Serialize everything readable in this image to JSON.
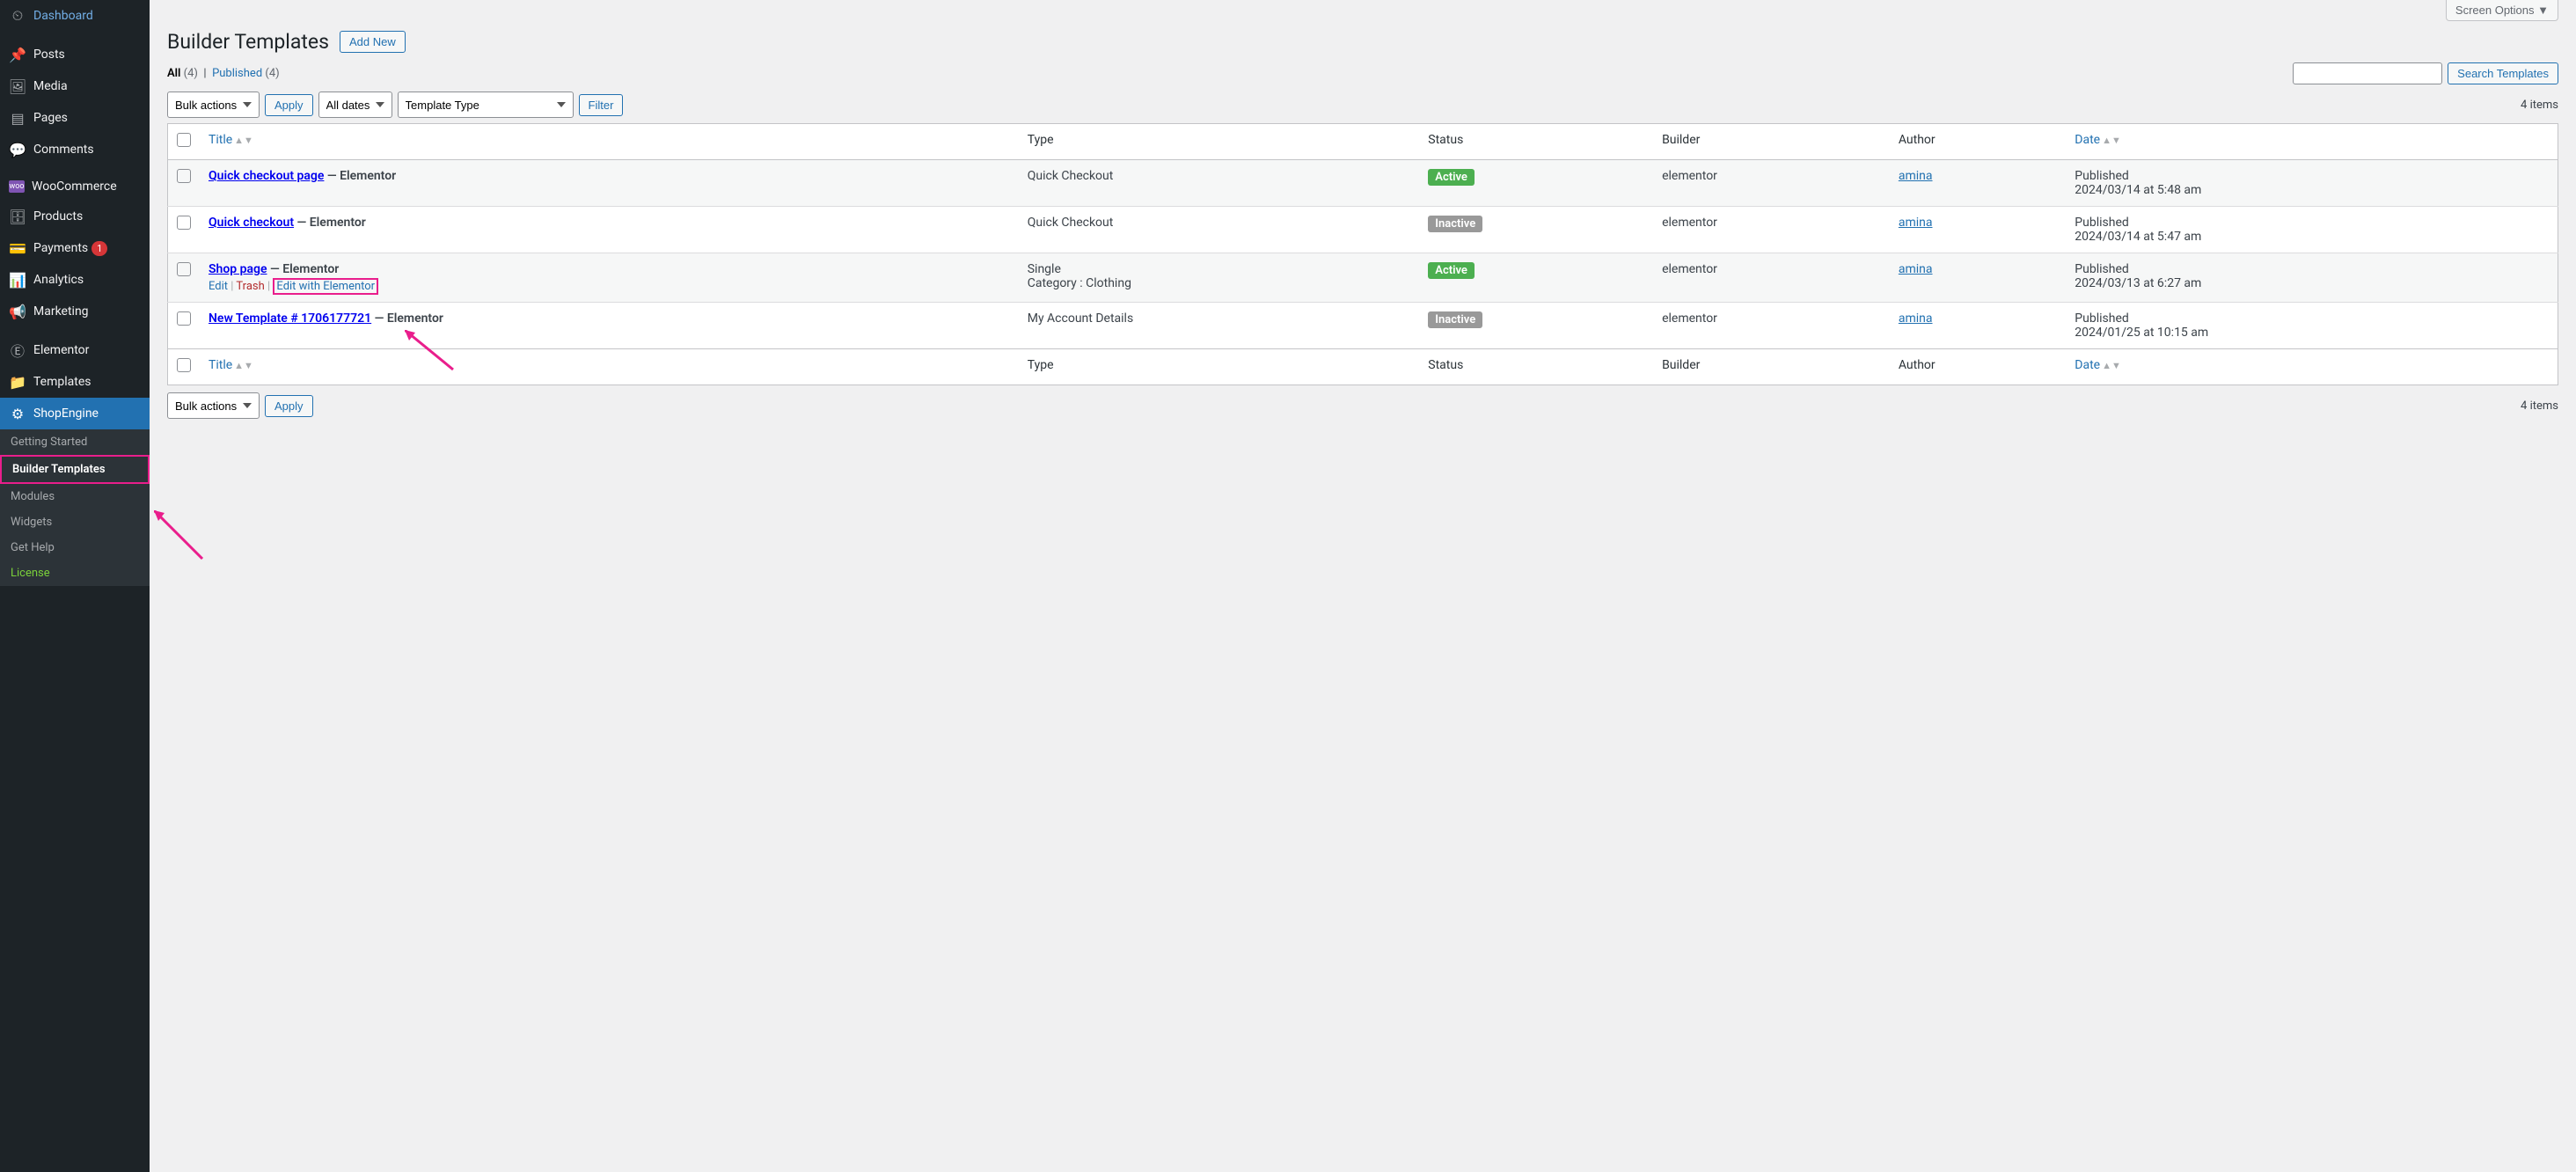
{
  "screen_options_label": "Screen Options  ▼",
  "page_title": "Builder Templates",
  "add_new_label": "Add New",
  "subsubsub": {
    "all_label": "All",
    "all_count": "(4)",
    "sep": "|",
    "published_label": "Published",
    "published_count": "(4)"
  },
  "search_btn": "Search Templates",
  "bulk_actions_label": "Bulk actions",
  "apply_label": "Apply",
  "all_dates_label": "All dates",
  "template_type_label": "Template Type",
  "filter_label": "Filter",
  "items_count": "4 items",
  "columns": {
    "title": "Title",
    "type": "Type",
    "status": "Status",
    "builder": "Builder",
    "author": "Author",
    "date": "Date"
  },
  "sidebar": {
    "items": [
      {
        "label": "Dashboard"
      },
      {
        "label": "Posts"
      },
      {
        "label": "Media"
      },
      {
        "label": "Pages"
      },
      {
        "label": "Comments"
      },
      {
        "label": "WooCommerce"
      },
      {
        "label": "Products"
      },
      {
        "label": "Payments",
        "badge": "1"
      },
      {
        "label": "Analytics"
      },
      {
        "label": "Marketing"
      },
      {
        "label": "Elementor"
      },
      {
        "label": "Templates"
      },
      {
        "label": "ShopEngine"
      }
    ],
    "submenu": [
      {
        "label": "Getting Started"
      },
      {
        "label": "Builder Templates"
      },
      {
        "label": "Modules"
      },
      {
        "label": "Widgets"
      },
      {
        "label": "Get Help"
      },
      {
        "label": "License"
      }
    ]
  },
  "row_actions": {
    "edit": "Edit",
    "trash": "Trash",
    "edit_elementor": "Edit with Elementor"
  },
  "rows": [
    {
      "title": "Quick checkout page",
      "suffix": " — Elementor",
      "type": "Quick Checkout",
      "type_line2": "",
      "status": "Active",
      "status_class": "active",
      "builder": "elementor",
      "author": "amina",
      "date_label": "Published",
      "date_value": "2024/03/14 at 5:48 am",
      "show_actions": false
    },
    {
      "title": "Quick checkout",
      "suffix": " — Elementor",
      "type": "Quick Checkout",
      "type_line2": "",
      "status": "Inactive",
      "status_class": "inactive",
      "builder": "elementor",
      "author": "amina",
      "date_label": "Published",
      "date_value": "2024/03/14 at 5:47 am",
      "show_actions": false
    },
    {
      "title": "Shop page",
      "suffix": " — Elementor",
      "type": "Single",
      "type_line2": "Category : Clothing",
      "status": "Active",
      "status_class": "active",
      "builder": "elementor",
      "author": "amina",
      "date_label": "Published",
      "date_value": "2024/03/13 at 6:27 am",
      "show_actions": true
    },
    {
      "title": "New Template # 1706177721",
      "suffix": " — Elementor",
      "type": "My Account Details",
      "type_line2": "",
      "status": "Inactive",
      "status_class": "inactive",
      "builder": "elementor",
      "author": "amina",
      "date_label": "Published",
      "date_value": "2024/01/25 at 10:15 am",
      "show_actions": false
    }
  ]
}
